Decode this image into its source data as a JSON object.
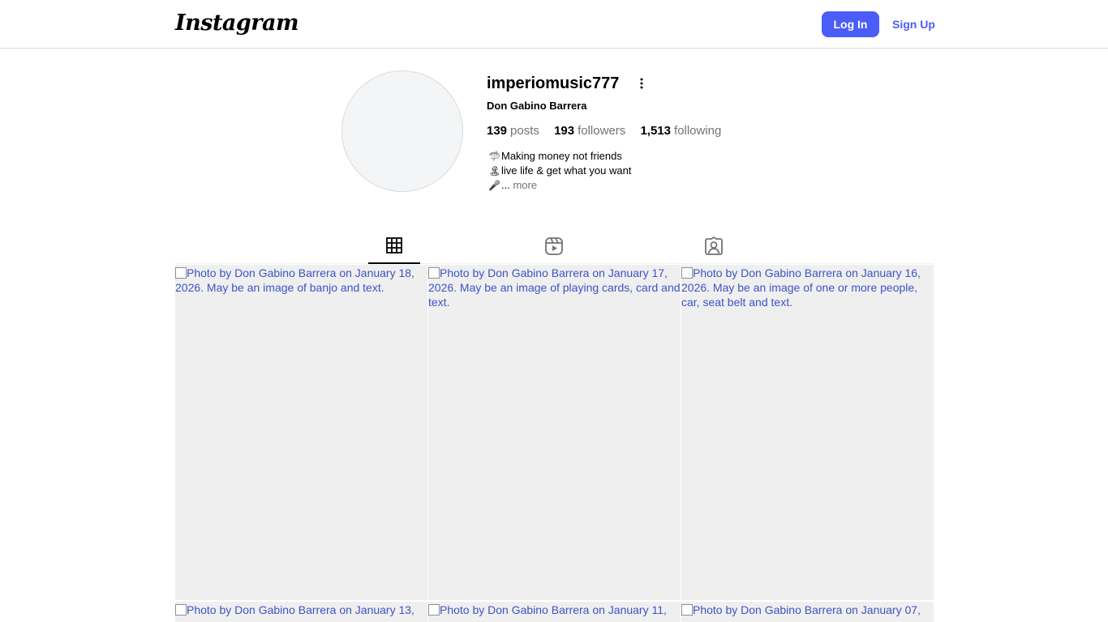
{
  "header": {
    "logo_text": "Instagram",
    "login_label": "Log In",
    "signup_label": "Sign Up",
    "accent_color": "#4a5df9"
  },
  "profile": {
    "username": "imperiomusic777",
    "full_name": "Don Gabino Barrera",
    "stats": {
      "posts_count": "139",
      "posts_label": "posts",
      "followers_count": "193",
      "followers_label": "followers",
      "following_count": "1,513",
      "following_label": "following"
    },
    "bio": [
      {
        "emoji": "🦈",
        "text": "Making money not friends"
      },
      {
        "emoji": "🏝",
        "text": "live life & get what you want"
      },
      {
        "emoji": "🎤",
        "text": "...",
        "more": "more"
      }
    ]
  },
  "tabs": [
    {
      "icon": "grid-icon",
      "active": true
    },
    {
      "icon": "reels-icon",
      "active": false
    },
    {
      "icon": "tagged-icon",
      "active": false
    }
  ],
  "posts": [
    {
      "alt": "Photo by Don Gabino Barrera on January 18, 2026. May be an image of banjo and text."
    },
    {
      "alt": "Photo by Don Gabino Barrera on January 17, 2026. May be an image of playing cards, card and text."
    },
    {
      "alt": "Photo by Don Gabino Barrera on January 16, 2026. May be an image of one or more people, car, seat belt and text."
    },
    {
      "alt": "Photo by Don Gabino Barrera on January 13,"
    },
    {
      "alt": "Photo by Don Gabino Barrera on January 11,"
    },
    {
      "alt": "Photo by Don Gabino Barrera on January 07,"
    }
  ]
}
